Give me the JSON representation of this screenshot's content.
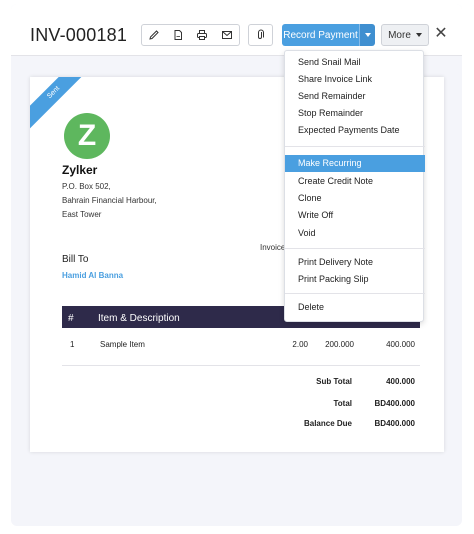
{
  "invoice": {
    "number": "INV-000181",
    "status_ribbon": "Sent",
    "invoice_label": "Invoice"
  },
  "toolbar": {
    "edit_icon": "pencil-icon",
    "pdf_icon": "pdf-file-icon",
    "print_icon": "printer-icon",
    "mail_icon": "mail-icon",
    "attach_icon": "paperclip-icon",
    "record_payment_label": "Record Payment",
    "more_label": "More",
    "close_glyph": "✕"
  },
  "organization": {
    "logo_letter": "Z",
    "logo_color": "#5eb75e",
    "name": "Zylker",
    "address": [
      "P.O. Box 502,",
      "Bahrain Financial Harbour,",
      "East Tower"
    ]
  },
  "bill_to": {
    "heading": "Bill To",
    "customer": "Hamid Al Banna"
  },
  "items_table": {
    "headers": {
      "num": "#",
      "item": "Item & Description"
    },
    "rows": [
      {
        "num": "1",
        "item": "Sample Item",
        "qty": "2.00",
        "rate": "200.000",
        "amount": "400.000"
      }
    ]
  },
  "totals": {
    "sub_total_label": "Sub Total",
    "sub_total_value": "400.000",
    "total_label": "Total",
    "total_value": "BD400.000",
    "balance_label": "Balance Due",
    "balance_value": "BD400.000"
  },
  "more_menu": {
    "group1": [
      "Send Snail Mail",
      "Share Invoice Link",
      "Send Remainder",
      "Stop Remainder",
      "Expected Payments Date"
    ],
    "group2": [
      "Make Recurring",
      "Create Credit Note",
      "Clone",
      "Write Off",
      "Void"
    ],
    "group3": [
      "Print Delivery Note",
      "Print Packing Slip"
    ],
    "group4": [
      "Delete"
    ],
    "highlighted": "Make Recurring"
  },
  "colors": {
    "accent": "#4a9fe0",
    "table_header": "#2e2a4a",
    "frame_bg": "#f4f5fa"
  }
}
